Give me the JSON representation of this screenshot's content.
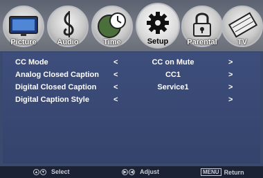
{
  "tabs": [
    {
      "label": "Picture",
      "icon": "tv-icon"
    },
    {
      "label": "Audio",
      "icon": "music-note-icon"
    },
    {
      "label": "Time",
      "icon": "clock-icon"
    },
    {
      "label": "Setup",
      "icon": "gear-icon",
      "active": true
    },
    {
      "label": "Parental",
      "icon": "lock-icon"
    },
    {
      "label": "TV",
      "icon": "film-icon"
    }
  ],
  "menu": {
    "rows": [
      {
        "label": "CC Mode",
        "left": "<",
        "value": "CC on Mute",
        "right": ">"
      },
      {
        "label": "Analog Closed Caption",
        "left": "<",
        "value": "CC1",
        "right": ">"
      },
      {
        "label": "Digital Closed Caption",
        "left": "<",
        "value": "Service1",
        "right": ">"
      },
      {
        "label": "Digital Caption Style",
        "left": "<",
        "value": "",
        "right": ">"
      }
    ]
  },
  "footer": {
    "select_label": "Select",
    "adjust_label": "Adjust",
    "menu_key": "MENU",
    "return_label": "Return",
    "up_glyph": "▲",
    "down_glyph": "▼",
    "right_glyph": "▶",
    "left_glyph": "◀"
  },
  "colors": {
    "panel": "#3a4a6e",
    "footer": "#1a2233",
    "text": "#ffffff"
  }
}
